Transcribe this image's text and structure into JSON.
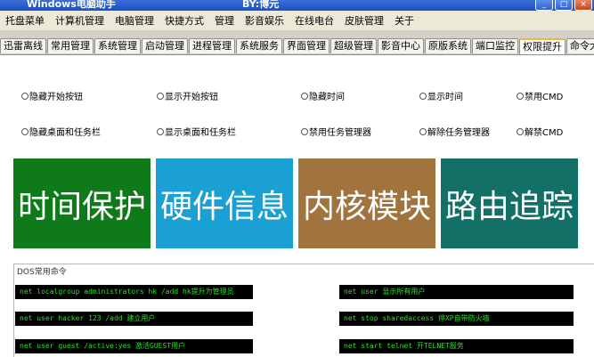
{
  "window": {
    "title": "Windows电脑助手",
    "author": "BY:博元",
    "controls": [
      "_",
      "□",
      "×"
    ]
  },
  "menu": [
    "托盘菜单",
    "计算机管理",
    "电脑管理",
    "快捷方式",
    "管理",
    "影音娱乐",
    "在线电台",
    "皮肤管理",
    "关于"
  ],
  "tabs": [
    "迅雷离线",
    "常用管理",
    "系统管理",
    "启动管理",
    "进程管理",
    "系统服务",
    "界面管理",
    "超级管理",
    "影音中心",
    "原版系统",
    "端口监控",
    "权限提升",
    "命令大全"
  ],
  "active_tab": "权限提升",
  "options_row1": [
    "隐藏开始按钮",
    "显示开始按钮",
    "隐藏时间",
    "显示时间",
    "禁用CMD"
  ],
  "options_row2": [
    "隐藏桌面和任务栏",
    "显示桌面和任务栏",
    "禁用任务管理器",
    "解除任务管理器",
    "解禁CMD"
  ],
  "tiles": [
    {
      "label": "时间保护",
      "color": "#0f7a1a"
    },
    {
      "label": "硬件信息",
      "color": "#1ba0d3"
    },
    {
      "label": "内核模块",
      "color": "#a0743c"
    },
    {
      "label": "路由追踪",
      "color": "#127066"
    }
  ],
  "dos": {
    "title": "DOS常用命令",
    "left": [
      "net localgroup administrators hk /add hk提升为管理员",
      "net user hacker 123 /add   建立用户",
      "net user guest /active:yes  激活GUEST用户"
    ],
    "right": [
      "net user 显示所有用户",
      "net stop sharedaccess 停XP自带防火墙",
      "net start telnet  开TELNET服务"
    ]
  }
}
